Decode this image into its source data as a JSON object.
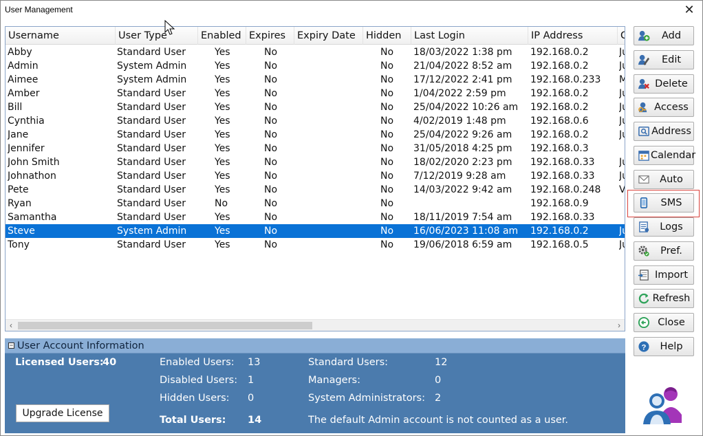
{
  "window": {
    "title": "User Management"
  },
  "grid": {
    "columns": [
      "Username",
      "User Type",
      "Enabled",
      "Expires",
      "Expiry Date",
      "Hidden",
      "Last Login",
      "IP Address",
      "C"
    ],
    "rows": [
      [
        "Abby",
        "Standard User",
        "Yes",
        "No",
        "",
        "No",
        "18/03/2022 1:38 pm",
        "192.168.0.2",
        "Ju"
      ],
      [
        "Admin",
        "System Admin",
        "Yes",
        "No",
        "",
        "No",
        "21/04/2022 8:52 am",
        "192.168.0.2",
        "Ju"
      ],
      [
        "Aimee",
        "System Admin",
        "Yes",
        "No",
        "",
        "No",
        "17/12/2022 2:41 pm",
        "192.168.0.233",
        "M"
      ],
      [
        "Amber",
        "Standard User",
        "Yes",
        "No",
        "",
        "No",
        "1/04/2022 2:59 pm",
        "192.168.0.2",
        "Ju"
      ],
      [
        "Bill",
        "Standard User",
        "Yes",
        "No",
        "",
        "No",
        "25/04/2022 10:26 am",
        "192.168.0.2",
        "Ju"
      ],
      [
        "Cynthia",
        "Standard User",
        "Yes",
        "No",
        "",
        "No",
        "4/02/2019 1:48 pm",
        "192.168.0.6",
        "Ju"
      ],
      [
        "Jane",
        "Standard User",
        "Yes",
        "No",
        "",
        "No",
        "25/04/2022 9:26 am",
        "192.168.0.2",
        "Ju"
      ],
      [
        "Jennifer",
        "Standard User",
        "Yes",
        "No",
        "",
        "No",
        "31/05/2018 4:25 pm",
        "192.168.0.3",
        ""
      ],
      [
        "John Smith",
        "Standard User",
        "Yes",
        "No",
        "",
        "No",
        "18/02/2020 2:23 pm",
        "192.168.0.33",
        "Ju"
      ],
      [
        "Johnathon",
        "Standard User",
        "Yes",
        "No",
        "",
        "No",
        "7/12/2019 9:28 am",
        "192.168.0.33",
        "Ju"
      ],
      [
        "Pete",
        "Standard User",
        "Yes",
        "No",
        "",
        "No",
        "14/03/2022 9:42 am",
        "192.168.0.248",
        "Vi"
      ],
      [
        "Ryan",
        "Standard User",
        "No",
        "No",
        "",
        "No",
        "",
        "192.168.0.9",
        ""
      ],
      [
        "Samantha",
        "Standard User",
        "Yes",
        "No",
        "",
        "No",
        "18/11/2019 7:54 am",
        "192.168.0.33",
        ""
      ],
      [
        "Steve",
        "System Admin",
        "Yes",
        "No",
        "",
        "No",
        "16/06/2023 11:08 am",
        "192.168.0.2",
        "Ju"
      ],
      [
        "Tony",
        "Standard User",
        "Yes",
        "No",
        "",
        "No",
        "19/06/2018 6:59 am",
        "192.168.0.5",
        "Ju"
      ]
    ],
    "selected_row": 13
  },
  "buttons": [
    {
      "label": "Add",
      "icon": "add-user-icon"
    },
    {
      "label": "Edit",
      "icon": "edit-user-icon"
    },
    {
      "label": "Delete",
      "icon": "delete-user-icon"
    },
    {
      "label": "Access",
      "icon": "access-key-icon"
    },
    {
      "label": "Address",
      "icon": "address-card-icon"
    },
    {
      "label": "Calendar",
      "icon": "calendar-icon"
    },
    {
      "label": "Auto",
      "icon": "envelope-icon"
    },
    {
      "label": "SMS",
      "icon": "phone-icon"
    },
    {
      "label": "Logs",
      "icon": "logs-icon"
    },
    {
      "label": "Pref.",
      "icon": "gear-icon"
    },
    {
      "label": "Import",
      "icon": "import-icon"
    },
    {
      "label": "Refresh",
      "icon": "refresh-icon"
    },
    {
      "label": "Close",
      "icon": "close-circle-icon"
    },
    {
      "label": "Help",
      "icon": "help-icon"
    }
  ],
  "info": {
    "header": "User Account Information",
    "licensed_label": "Licensed Users:",
    "licensed_value": "40",
    "enabled_label": "Enabled Users:",
    "enabled_value": "13",
    "disabled_label": "Disabled Users:",
    "disabled_value": "1",
    "hidden_label": "Hidden Users:",
    "hidden_value": "0",
    "total_label": "Total Users:",
    "total_value": "14",
    "standard_label": "Standard Users:",
    "standard_value": "12",
    "managers_label": "Managers:",
    "managers_value": "0",
    "sysadmin_label": "System Administrators:",
    "sysadmin_value": "2",
    "note": "The default Admin account is not counted as a user.",
    "upgrade_label": "Upgrade License"
  },
  "colors": {
    "selection": "#0a72d6",
    "panel": "#4b7bad",
    "highlight": "#d9423c"
  }
}
